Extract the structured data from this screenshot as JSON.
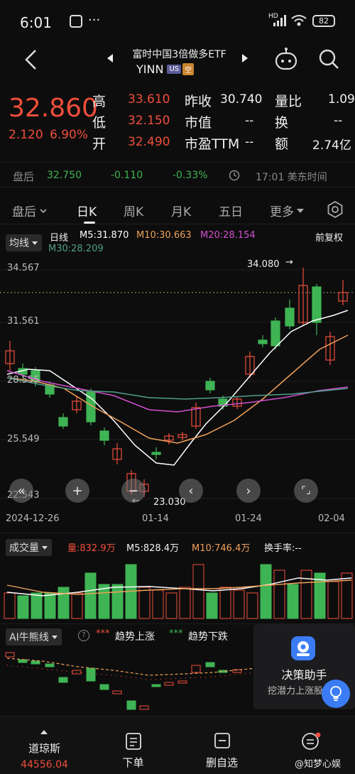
{
  "status_bar": {
    "time": "6:01",
    "network": "HD",
    "battery": "82"
  },
  "header": {
    "title": "富时中国3倍做多ETF",
    "symbol": "YINN",
    "badge_market": "US",
    "badge_short": "空"
  },
  "quote": {
    "price": "32.860",
    "change": "2.120",
    "change_pct": "6.90%",
    "stats": [
      {
        "label": "高",
        "value": "33.610",
        "label2": "昨收",
        "value2": "30.740",
        "label3": "量比",
        "value3": "1.09"
      },
      {
        "label": "低",
        "value": "32.150",
        "label2": "市值",
        "value2": "--",
        "label3": "换",
        "value3": "--"
      },
      {
        "label": "开",
        "value": "32.490",
        "label2": "市盈TTM",
        "value2": "--",
        "label3": "额",
        "value3": "2.74亿"
      }
    ]
  },
  "after_hours": {
    "label": "盘后",
    "price": "32.750",
    "change": "-0.110",
    "change_pct": "-0.33%",
    "time": "17:01 美东时间"
  },
  "period_tabs": [
    "盘后",
    "日K",
    "周K",
    "月K",
    "五日",
    "更多"
  ],
  "active_tab": "日K",
  "ma_legend": {
    "selector": "均线",
    "kind": "日线",
    "m5": "M5:31.870",
    "m10": "M10:30.663",
    "m20": "M20:28.154",
    "m30": "M30:28.209",
    "adjust": "前复权"
  },
  "price_chart": {
    "y_ticks": [
      "34.567",
      "31.561",
      "28.555",
      "25.549",
      "22.543"
    ],
    "high_annotation": "34.080",
    "low_annotation": "23.030",
    "dates": [
      "2024-12-26",
      "01-14",
      "01-24",
      "02-04"
    ]
  },
  "volume_legend": {
    "selector": "成交量",
    "vol": "量:832.9万",
    "m5": "M5:828.4万",
    "m10": "M10:746.4万",
    "turnover": "换手率:--"
  },
  "ai_legend": {
    "selector": "AI牛熊线",
    "up": "趋势上涨",
    "down": "趋势下跌"
  },
  "assistant": {
    "title": "决策助手",
    "subtitle": "挖潜力上涨股"
  },
  "bottom_nav": [
    {
      "label": "道琼斯",
      "value": "44556.04"
    },
    {
      "label": "下单"
    },
    {
      "label": "删自选"
    },
    {
      "label": "@知梦心娱"
    }
  ],
  "colors": {
    "up": "#ef4e3c",
    "down": "#3fb454",
    "m5": "#ffffff",
    "m10": "#f0a15a",
    "m20": "#d24fd0",
    "m30": "#4f9e8a"
  }
}
